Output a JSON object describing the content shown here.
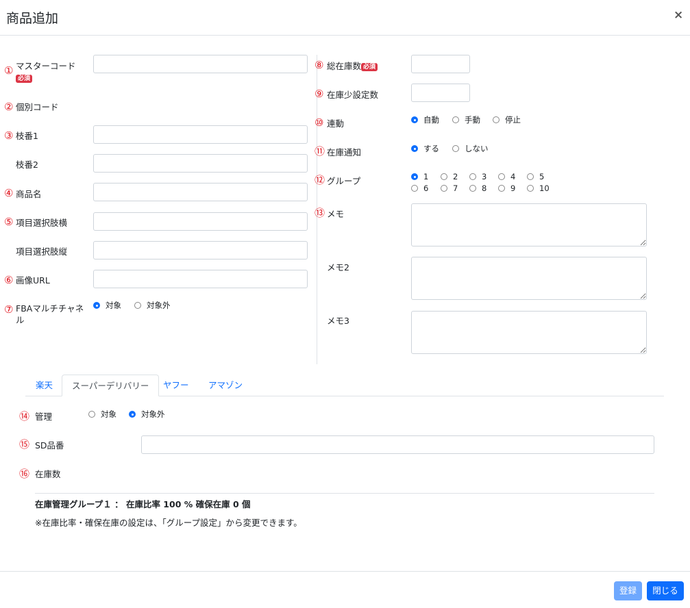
{
  "modal": {
    "title": "商品追加",
    "close": "×"
  },
  "required_badge": "必須",
  "left": {
    "master_code": {
      "num": "①",
      "label": "マスターコード"
    },
    "individual_code": {
      "num": "②",
      "label": "個別コード"
    },
    "branch1": {
      "num": "③",
      "label": "枝番1"
    },
    "branch2": {
      "label": "枝番2"
    },
    "product_name": {
      "num": "④",
      "label": "商品名"
    },
    "item_h": {
      "num": "⑤",
      "label": "項目選択肢横"
    },
    "item_v": {
      "label": "項目選択肢縦"
    },
    "image_url": {
      "num": "⑥",
      "label": "画像URL"
    },
    "fba": {
      "num": "⑦",
      "label": "FBAマルチチャネル",
      "options": [
        "対象",
        "対象外"
      ],
      "selected": "対象"
    }
  },
  "right": {
    "total_stock": {
      "num": "⑧",
      "label": "総在庫数"
    },
    "low_stock": {
      "num": "⑨",
      "label": "在庫少設定数"
    },
    "link": {
      "num": "⑩",
      "label": "連動",
      "options": [
        "自動",
        "手動",
        "停止"
      ],
      "selected": "自動"
    },
    "notify": {
      "num": "⑪",
      "label": "在庫通知",
      "options": [
        "する",
        "しない"
      ],
      "selected": "する"
    },
    "group": {
      "num": "⑫",
      "label": "グループ",
      "options": [
        "1",
        "2",
        "3",
        "4",
        "5",
        "6",
        "7",
        "8",
        "9",
        "10"
      ],
      "selected": "1"
    },
    "memo": {
      "num": "⑬",
      "label": "メモ"
    },
    "memo2": {
      "label": "メモ2"
    },
    "memo3": {
      "label": "メモ3"
    }
  },
  "tabs": [
    "楽天",
    "スーパーデリバリー",
    "ヤフー",
    "アマゾン"
  ],
  "active_tab": "スーパーデリバリー",
  "sd": {
    "manage": {
      "num": "⑭",
      "label": "管理",
      "options": [
        "対象",
        "対象外"
      ],
      "selected": "対象外"
    },
    "sd_code": {
      "num": "⑮",
      "label": "SD品番"
    },
    "stock": {
      "num": "⑯",
      "label": "在庫数"
    },
    "group_info": "在庫管理グループ１ ： 在庫比率 100 % 確保在庫 0 個",
    "note": "※在庫比率・確保在庫の設定は、「グループ設定」から変更できます。"
  },
  "buttons": {
    "register": "登録",
    "close": "閉じる"
  },
  "colors": {
    "primary": "#0d6efd",
    "primary_disabled": "#6ea8fe",
    "required": "#dc3545",
    "number": "#e0161f"
  }
}
